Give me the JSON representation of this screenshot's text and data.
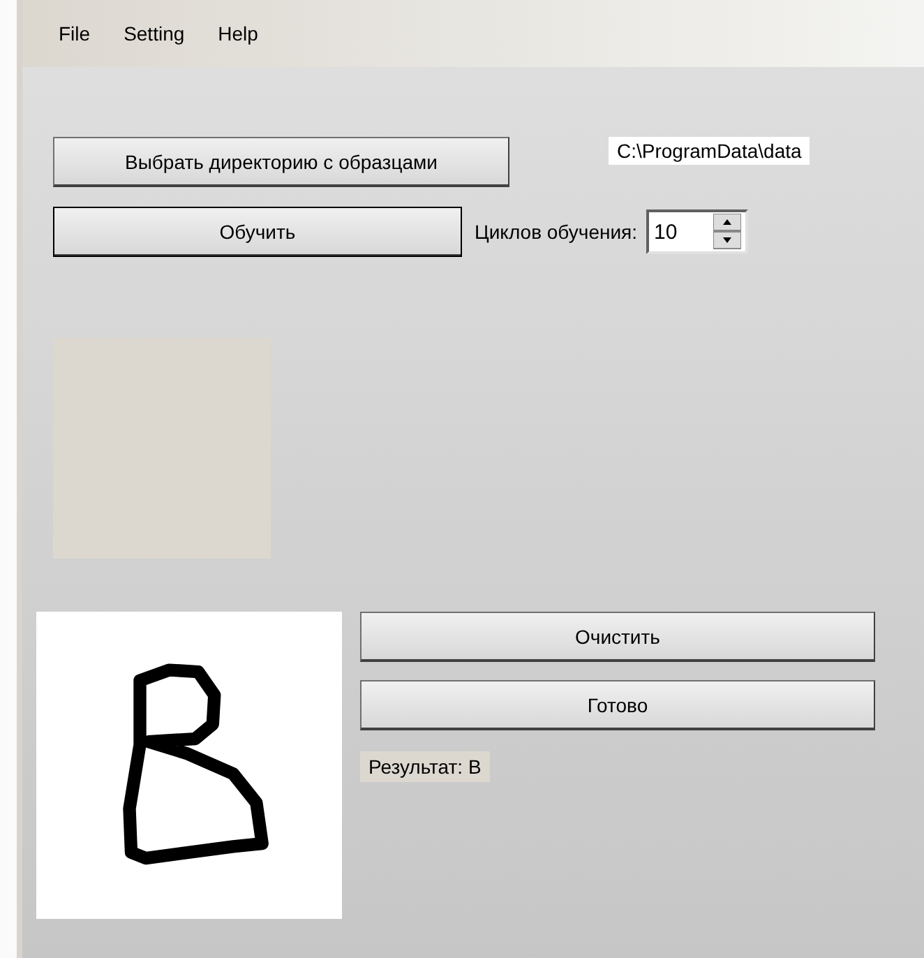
{
  "menu": [
    "File",
    "Setting",
    "Help"
  ],
  "choose_button": "Выбрать директорию с образцами",
  "path": "C:\\ProgramData\\data",
  "train_button": {
    "label": "Обучить",
    "default": true
  },
  "cycles": {
    "label": "Циклов обучения:",
    "value": "10"
  },
  "clear_button": "Очистить",
  "done_button": "Готово",
  "result": "Результат:  B"
}
